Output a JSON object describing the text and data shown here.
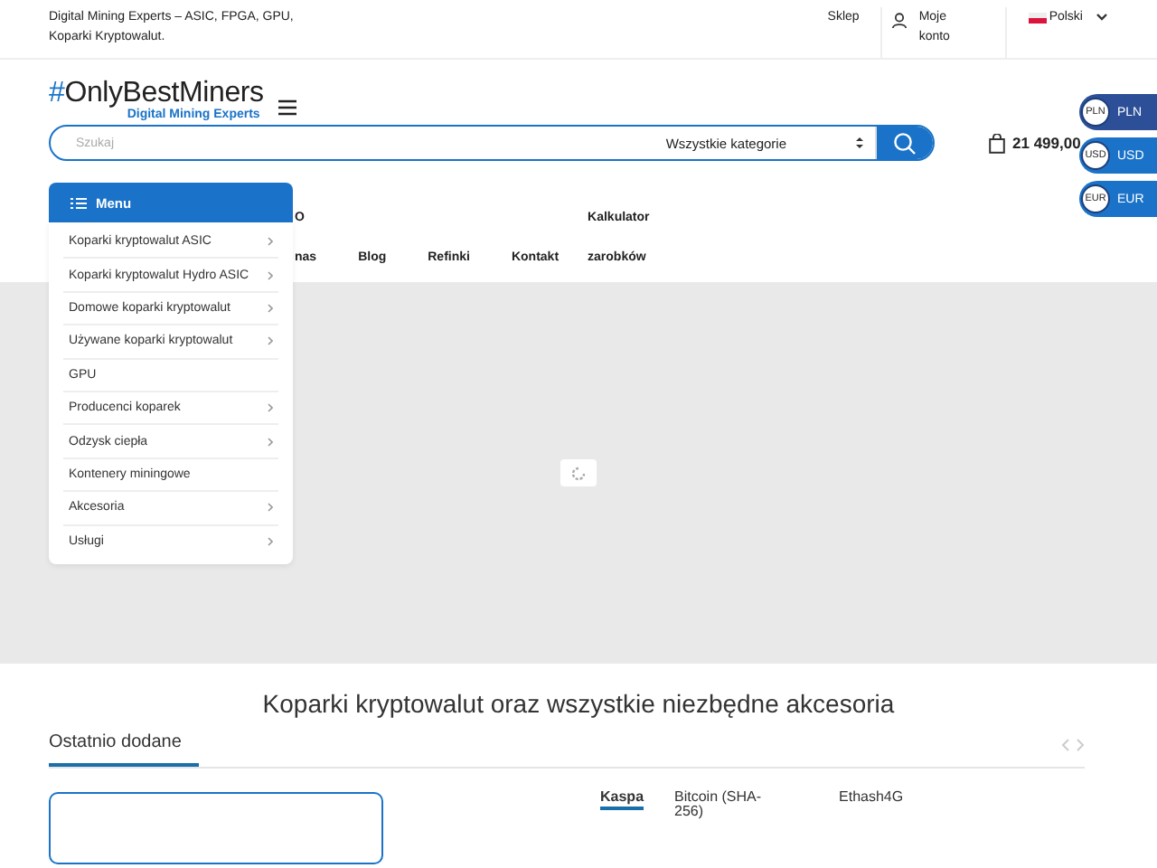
{
  "top_bar": {
    "tagline": "Digital Mining Experts – ASIC, FPGA, GPU, Koparki Kryptowalut.",
    "links": [
      {
        "label": "Sklep",
        "kind": "text"
      },
      {
        "label": "Moje konto",
        "kind": "account"
      }
    ],
    "language": "Polski"
  },
  "header": {
    "logo_hash": "#",
    "logo_name": "OnlyBestMiners",
    "logo_subtitle": "Digital Mining Experts",
    "search": {
      "placeholder": "Szukaj",
      "category": "Wszystkie kategorie"
    },
    "cart_total": "21 499,00"
  },
  "currencies": [
    {
      "code": "PLN",
      "label": "PLN",
      "selected": true
    },
    {
      "code": "USD",
      "label": "USD",
      "selected": false
    },
    {
      "code": "EUR",
      "label": "EUR",
      "selected": false
    }
  ],
  "menu": {
    "label": "Menu",
    "items": [
      {
        "label": "Koparki kryptowalut ASIC",
        "has_children": true
      },
      {
        "label": "Koparki kryptowalut Hydro ASIC",
        "has_children": true
      },
      {
        "label": "Domowe koparki kryptowalut",
        "has_children": true
      },
      {
        "label": "Używane koparki kryptowalut",
        "has_children": true
      },
      {
        "label": "GPU",
        "has_children": false
      },
      {
        "label": "Producenci koparek",
        "has_children": true
      },
      {
        "label": "Odzysk ciepła",
        "has_children": true
      },
      {
        "label": "Kontenery miningowe",
        "has_children": false
      },
      {
        "label": "Akcesoria",
        "has_children": true
      },
      {
        "label": "Usługi",
        "has_children": true
      }
    ]
  },
  "nav": [
    "O nas",
    "Blog",
    "Refinki",
    "Kontakt",
    "Kalkulator zarobków"
  ],
  "section": {
    "title": "Koparki kryptowalut oraz wszystkie niezbędne akcesoria",
    "tabs": [
      {
        "label": "Ostatnio dodane",
        "selected": true
      }
    ],
    "algo_tabs": [
      {
        "label": "Kaspa",
        "selected": true
      },
      {
        "label": "Bitcoin (SHA-256)",
        "selected": false
      },
      {
        "label": "Ethash4G",
        "selected": false
      }
    ]
  }
}
